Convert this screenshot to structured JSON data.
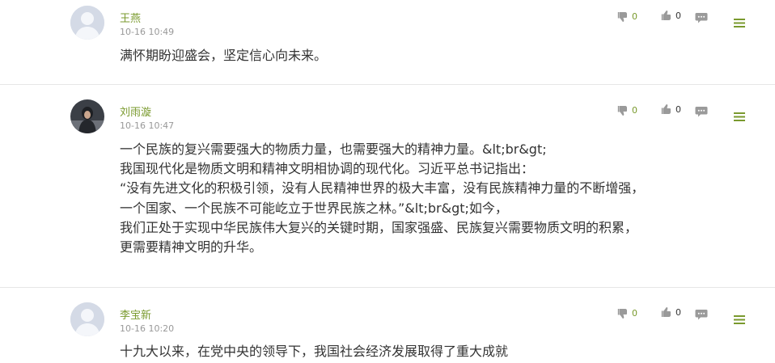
{
  "colors": {
    "username": "#7a9a2e",
    "timestamp": "#999999",
    "text": "#333333",
    "icon_gray": "#9a9a9a",
    "menu_green": "#7a9a2e"
  },
  "comments": [
    {
      "username": "王燕",
      "time": "10-16 10:49",
      "avatar": "default-avatar",
      "lines": [
        "满怀期盼迎盛会，坚定信心向未来。"
      ],
      "dislike_count": "0",
      "like_count": "0"
    },
    {
      "username": "刘雨漩",
      "time": "10-16 10:47",
      "avatar": "photo-avatar",
      "lines": [
        "一个民族的复兴需要强大的物质力量，也需要强大的精神力量。&lt;br&gt;",
        "我国现代化是物质文明和精神文明相协调的现代化。习近平总书记指出：",
        "“没有先进文化的积极引领，没有人民精神世界的极大丰富，没有民族精神力量的不断增强，",
        "一个国家、一个民族不可能屹立于世界民族之林。”&lt;br&gt;如今，",
        "我们正处于实现中华民族伟大复兴的关键时期，国家强盛、民族复兴需要物质文明的积累，",
        "更需要精神文明的升华。"
      ],
      "dislike_count": "0",
      "like_count": "0"
    },
    {
      "username": "李宝新",
      "time": "10-16 10:20",
      "avatar": "default-avatar",
      "lines": [
        "十九大以来，在党中央的领导下，我国社会经济发展取得了重大成就"
      ],
      "dislike_count": "0",
      "like_count": "0"
    }
  ]
}
